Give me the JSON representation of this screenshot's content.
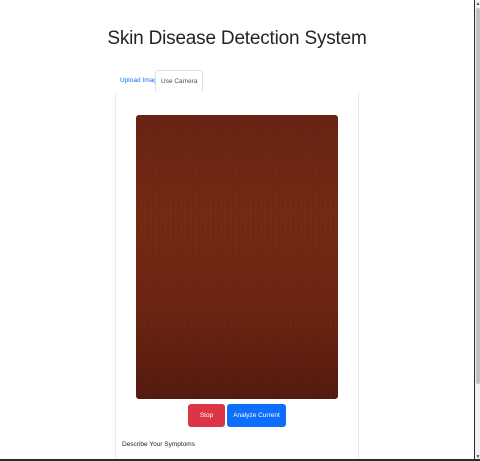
{
  "page": {
    "title": "Skin Disease Detection System"
  },
  "tabs": [
    {
      "label": "Upload Image",
      "active": false
    },
    {
      "label": "Use Camera",
      "active": true
    }
  ],
  "camera": {
    "feed_icon": "camera-feed"
  },
  "buttons": {
    "stop_label": "Stop Camera",
    "analyze_label": "Analyze Current Frame"
  },
  "form": {
    "symptoms_label": "Describe Your Symptoms"
  },
  "colors": {
    "primary": "#0d6efd",
    "danger": "#dc3545",
    "feed": "#772b13"
  }
}
